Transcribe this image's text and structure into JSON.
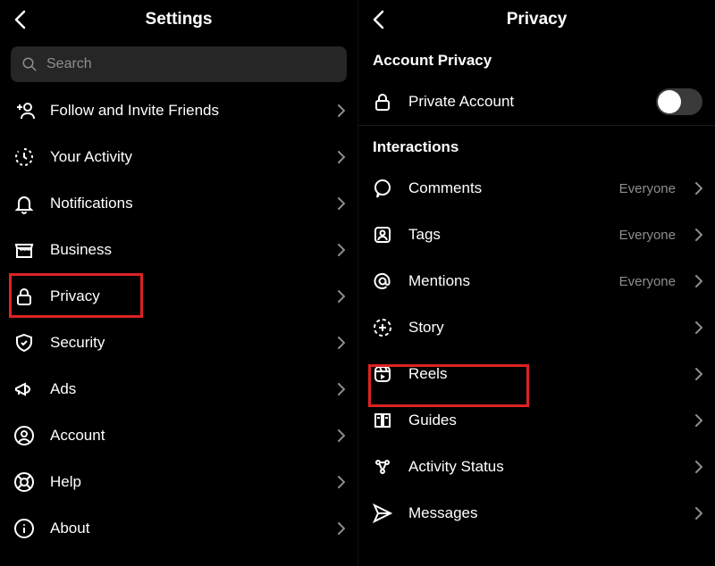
{
  "left": {
    "title": "Settings",
    "search_placeholder": "Search",
    "items": [
      {
        "label": "Follow and Invite Friends"
      },
      {
        "label": "Your Activity"
      },
      {
        "label": "Notifications"
      },
      {
        "label": "Business"
      },
      {
        "label": "Privacy"
      },
      {
        "label": "Security"
      },
      {
        "label": "Ads"
      },
      {
        "label": "Account"
      },
      {
        "label": "Help"
      },
      {
        "label": "About"
      }
    ]
  },
  "right": {
    "title": "Privacy",
    "section_account": "Account Privacy",
    "private_account": "Private Account",
    "section_interactions": "Interactions",
    "items": [
      {
        "label": "Comments",
        "value": "Everyone"
      },
      {
        "label": "Tags",
        "value": "Everyone"
      },
      {
        "label": "Mentions",
        "value": "Everyone"
      },
      {
        "label": "Story"
      },
      {
        "label": "Reels"
      },
      {
        "label": "Guides"
      },
      {
        "label": "Activity Status"
      },
      {
        "label": "Messages"
      }
    ]
  }
}
